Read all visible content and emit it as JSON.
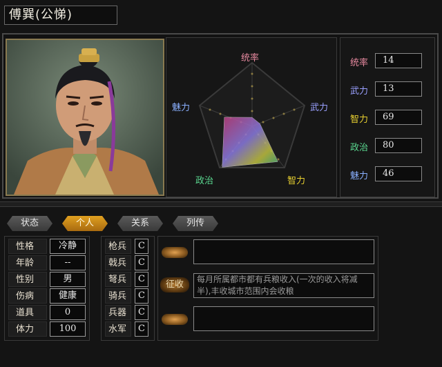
{
  "header": {
    "name": "傅巽(公悌)"
  },
  "radar": {
    "labels": {
      "tongshuai": "统率",
      "wuli": "武力",
      "zhili": "智力",
      "zhengzhi": "政治",
      "meili": "魅力"
    },
    "colors": {
      "tongshuai": "#e88aa0",
      "wuli": "#9aa0ff",
      "zhili": "#e8d030",
      "zhengzhi": "#5ad890",
      "meili": "#8ab0ff"
    }
  },
  "stats": [
    {
      "label": "统率",
      "value": "14",
      "color": "#e88aa0"
    },
    {
      "label": "武力",
      "value": "13",
      "color": "#9aa0ff"
    },
    {
      "label": "智力",
      "value": "69",
      "color": "#e8d030"
    },
    {
      "label": "政治",
      "value": "80",
      "color": "#5ad890"
    },
    {
      "label": "魅力",
      "value": "46",
      "color": "#8ab0ff"
    }
  ],
  "tabs": [
    {
      "label": "状态"
    },
    {
      "label": "个人",
      "active": true
    },
    {
      "label": "关系"
    },
    {
      "label": "列传"
    }
  ],
  "attributes": [
    {
      "label": "性格",
      "value": "冷静"
    },
    {
      "label": "年龄",
      "value": "--"
    },
    {
      "label": "性别",
      "value": "男"
    },
    {
      "label": "伤病",
      "value": "健康"
    },
    {
      "label": "道具",
      "value": "0"
    },
    {
      "label": "体力",
      "value": "100"
    }
  ],
  "aptitudes": [
    {
      "label": "枪兵",
      "value": "C"
    },
    {
      "label": "戟兵",
      "value": "C"
    },
    {
      "label": "弩兵",
      "value": "C"
    },
    {
      "label": "骑兵",
      "value": "C"
    },
    {
      "label": "兵器",
      "value": "C"
    },
    {
      "label": "水军",
      "value": "C"
    }
  ],
  "skill": {
    "name": "征收",
    "description": "每月所属都市都有兵粮收入(一次的收入将减半),丰收城市范围内会收粮"
  }
}
